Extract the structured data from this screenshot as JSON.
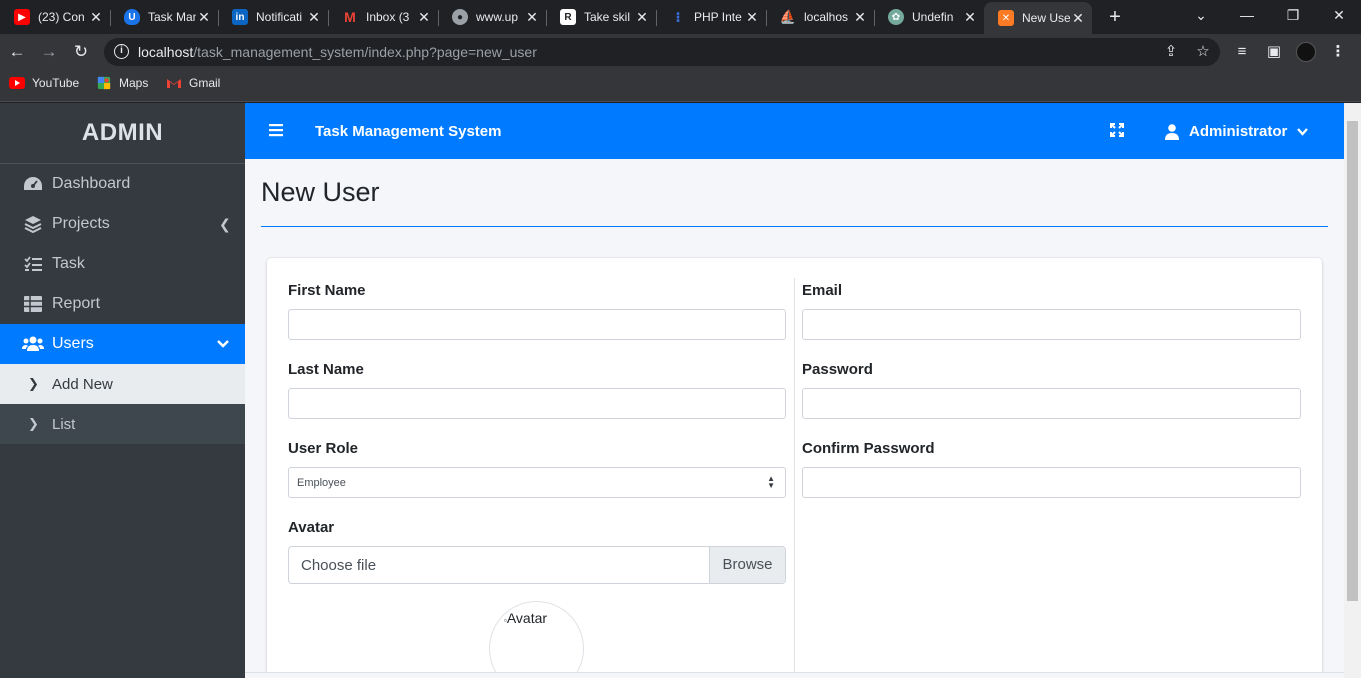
{
  "browser": {
    "tabs": [
      {
        "title": "(23) Con",
        "favicon": "youtube-icon",
        "color": "#ff0000"
      },
      {
        "title": "Task Man",
        "favicon": "shield-icon",
        "color": "#1a73e8"
      },
      {
        "title": "Notificati",
        "favicon": "linkedin-icon",
        "color": "#0a66c2"
      },
      {
        "title": "Inbox (3",
        "favicon": "gmail-icon",
        "color": "#ea4335"
      },
      {
        "title": "www.up",
        "favicon": "globe-icon",
        "color": "#9aa0a6"
      },
      {
        "title": "Take skil",
        "favicon": "r-logo-icon",
        "color": "#ffffff"
      },
      {
        "title": "PHP Inte",
        "favicon": "php-icon",
        "color": "#1a3fa8"
      },
      {
        "title": "localhos",
        "favicon": "phpmyadmin-icon",
        "color": "#f29111"
      },
      {
        "title": "Undefin",
        "favicon": "chatgpt-icon",
        "color": "#74aa9c"
      },
      {
        "title": "New Use",
        "favicon": "xampp-icon",
        "color": "#fb7a24",
        "active": true
      }
    ],
    "url_host": "localhost",
    "url_path": "/task_management_system/index.php?page=new_user",
    "bookmarks": [
      {
        "label": "YouTube",
        "icon": "youtube-icon"
      },
      {
        "label": "Maps",
        "icon": "maps-icon"
      },
      {
        "label": "Gmail",
        "icon": "gmail-icon"
      }
    ]
  },
  "app": {
    "brand": "ADMIN",
    "header_title": "Task Management System",
    "user_name": "Administrator",
    "colors": {
      "primary": "#007bff",
      "sidebar": "#343a40"
    }
  },
  "sidebar": {
    "items": [
      {
        "label": "Dashboard",
        "icon": "tachometer-icon"
      },
      {
        "label": "Projects",
        "icon": "layers-icon"
      },
      {
        "label": "Task",
        "icon": "tasks-icon"
      },
      {
        "label": "Report",
        "icon": "table-icon"
      },
      {
        "label": "Users",
        "icon": "users-icon",
        "active": true
      }
    ],
    "users_sub": [
      {
        "label": "Add New",
        "current": true
      },
      {
        "label": "List"
      }
    ]
  },
  "page": {
    "title": "New User"
  },
  "form": {
    "first_name_label": "First Name",
    "first_name_value": "",
    "last_name_label": "Last Name",
    "last_name_value": "",
    "role_label": "User Role",
    "role_selected": "Employee",
    "avatar_label": "Avatar",
    "file_placeholder": "Choose file",
    "browse_label": "Browse",
    "avatar_alt": "Avatar",
    "email_label": "Email",
    "email_value": "",
    "password_label": "Password",
    "confirm_password_label": "Confirm Password"
  }
}
